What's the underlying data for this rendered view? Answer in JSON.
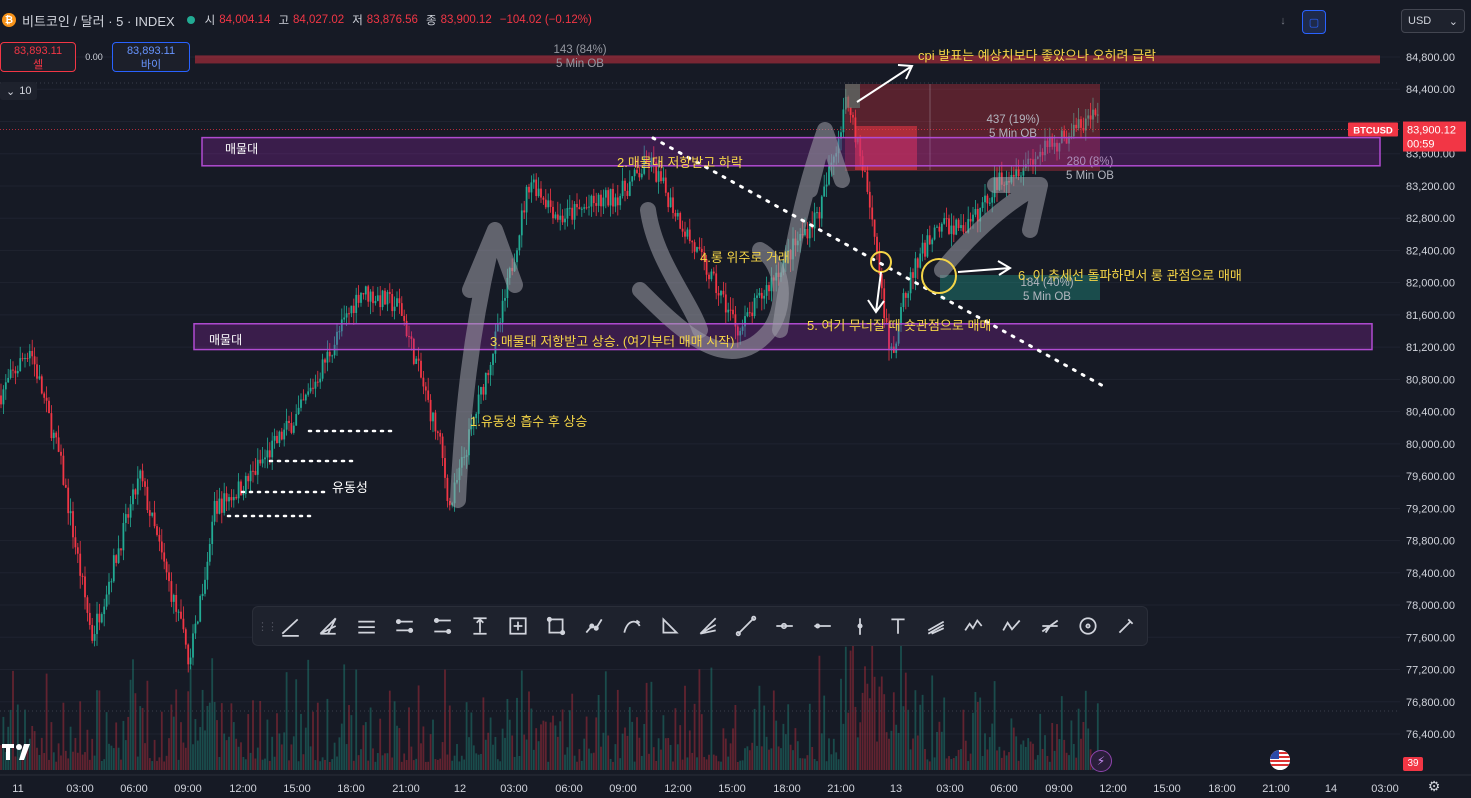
{
  "header": {
    "symbol_icon": "bitcoin-icon",
    "symbol_icon_glyph": "₿",
    "title": "비트코인 / 달러 · 5 · INDEX",
    "ohlc": [
      {
        "key": "시",
        "value": "84,004.14"
      },
      {
        "key": "고",
        "value": "84,027.02"
      },
      {
        "key": "저",
        "value": "83,876.56"
      },
      {
        "key": "종",
        "value": "83,900.12"
      }
    ],
    "change": "−104.02 (−0.12%)",
    "currency": "USD"
  },
  "trade": {
    "sell_price": "83,893.11",
    "sell_label": "셀",
    "spread": "0.00",
    "buy_price": "83,893.11",
    "buy_label": "바이"
  },
  "volume_chip": "10",
  "colors": {
    "background": "#161a25",
    "up": "#22ab94",
    "down": "#f23645",
    "zone": "#9c27b0",
    "annotation": "#f5d547",
    "last_price": "#f23645"
  },
  "price_axis": {
    "labels": [
      "84,800.00",
      "84,400.00",
      "83,600.00",
      "83,200.00",
      "82,800.00",
      "82,400.00",
      "82,000.00",
      "81,600.00",
      "81,200.00",
      "80,800.00",
      "80,400.00",
      "80,000.00",
      "79,600.00",
      "79,200.00",
      "78,800.00",
      "78,400.00",
      "78,000.00",
      "77,600.00",
      "77,200.00",
      "76,800.00",
      "76,400.00"
    ],
    "last_symbol": "BTCUSD",
    "last_price": "83,900.12",
    "countdown": "00:59"
  },
  "time_axis": {
    "labels": [
      "11",
      "03:00",
      "06:00",
      "09:00",
      "12:00",
      "15:00",
      "18:00",
      "21:00",
      "12",
      "03:00",
      "06:00",
      "09:00",
      "12:00",
      "15:00",
      "18:00",
      "21:00",
      "13",
      "03:00",
      "06:00",
      "09:00",
      "12:00",
      "15:00",
      "18:00",
      "21:00",
      "14",
      "03:00"
    ]
  },
  "zones": [
    {
      "label": "매물대",
      "from": 83450,
      "to": 83800
    },
    {
      "label": "매물대",
      "from": 81170,
      "to": 81490
    }
  ],
  "order_blocks": [
    {
      "stat": "143 (84%)",
      "label": "5 Min OB",
      "from": 84820,
      "to": 84720
    },
    {
      "stat": "437 (19%)",
      "label": "5 Min OB"
    },
    {
      "stat": "280 (8%)",
      "label": "5 Min OB"
    },
    {
      "stat": "184 (40%)",
      "label": "5 Min OB"
    }
  ],
  "annotations": [
    {
      "text": "cpi 발표는 예상치보다 좋았으나 오히려 급락"
    },
    {
      "text": "2.매물대 저항받고 하락"
    },
    {
      "text": "4.롱 위주로 거래"
    },
    {
      "text": "6. 이 추세선 돌파하면서 롱 관점으로 매매"
    },
    {
      "text": "5. 여기 무너질 때 숏관점으로 매매"
    },
    {
      "text": "3.매물대 저항받고 상승. (여기부터 매매 시작)"
    },
    {
      "text": "1.유동성 흡수 후 상승"
    },
    {
      "text": "유동성"
    }
  ],
  "drawing_tools": [
    "trend-line-icon",
    "pitchfork-icon",
    "parallel-channel-icon",
    "regression-channel-icon",
    "flat-top-icon",
    "price-range-icon",
    "measure-icon",
    "rectangle-icon",
    "path-icon",
    "curve-icon",
    "triangle-icon",
    "fib-fan-icon",
    "line-icon",
    "horizontal-ray-icon",
    "horizontal-line-icon",
    "vertical-line-icon",
    "text-icon",
    "gann-fan-icon",
    "elliott-wave-icon",
    "abcd-pattern-icon",
    "fib-retracement-icon",
    "circle-icon",
    "brush-icon"
  ],
  "bottom": {
    "badge": "39",
    "flash_icon": "lightning-icon",
    "flag_icon": "us-flag-icon",
    "settings_icon": "gear-icon"
  }
}
